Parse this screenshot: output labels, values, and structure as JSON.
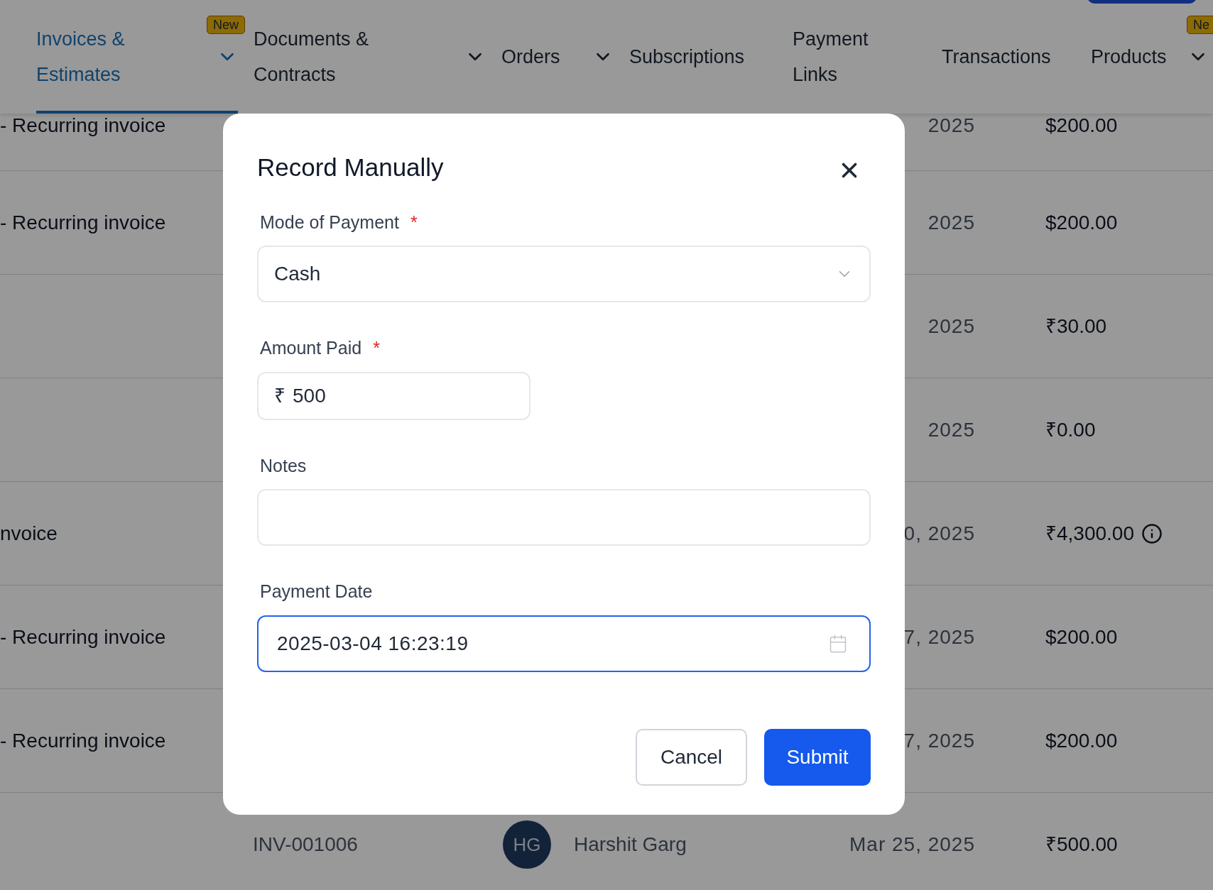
{
  "nav": {
    "tabs": [
      {
        "label": "Invoices & Estimates",
        "selected": true,
        "dropdown": true,
        "badge": "New"
      },
      {
        "label": "Documents & Contracts",
        "selected": false,
        "dropdown": true
      },
      {
        "label": "Orders",
        "selected": false,
        "dropdown": true
      },
      {
        "label": "Subscriptions",
        "selected": false,
        "dropdown": false
      },
      {
        "label": "Payment Links",
        "selected": false,
        "dropdown": false
      },
      {
        "label": "Transactions",
        "selected": false,
        "dropdown": false
      },
      {
        "label": "Products",
        "selected": false,
        "dropdown": true,
        "badge": "Ne"
      }
    ]
  },
  "table": {
    "rows": [
      {
        "column_1": "- Recurring invoice",
        "column_4": "2025",
        "column_5": "$200.00",
        "info": false
      },
      {
        "column_1": "- Recurring invoice",
        "column_4": "2025",
        "column_5": "$200.00",
        "info": false
      },
      {
        "column_4": "2025",
        "column_5": "₹30.00",
        "info": false
      },
      {
        "column_4": "2025",
        "column_5": "₹0.00",
        "info": false
      },
      {
        "column_1": "nvoice",
        "column_4": "0, 2025",
        "column_5": "₹4,300.00",
        "info": true
      },
      {
        "column_1": "- Recurring invoice",
        "column_4": "7, 2025",
        "column_5": "$200.00",
        "info": false
      },
      {
        "column_1": "- Recurring invoice",
        "column_4": "7, 2025",
        "column_5": "$200.00",
        "info": false
      },
      {
        "column_2": "INV-001006",
        "avatar": "HG",
        "column_3": "Harshit Garg",
        "column_4": "Mar 25, 2025",
        "column_5": "₹500.00",
        "info": false
      }
    ]
  },
  "dialog": {
    "title": "Record Manually",
    "fields": [
      {
        "kind": "select",
        "label": "Mode of Payment",
        "required_mark": "*",
        "value": "Cash",
        "focused": false
      },
      {
        "kind": "currency",
        "label": "Amount Paid",
        "required_mark": "*",
        "prefix": "₹",
        "value": "500",
        "focused": false
      },
      {
        "kind": "textarea",
        "label": "Notes",
        "focused": false
      },
      {
        "kind": "date",
        "label": "Payment Date",
        "value": "2025-03-04 16:23:19",
        "focused": true
      }
    ],
    "buttons": [
      {
        "label": "Cancel",
        "kind": "secondary"
      },
      {
        "label": "Submit",
        "kind": "primary"
      }
    ]
  }
}
